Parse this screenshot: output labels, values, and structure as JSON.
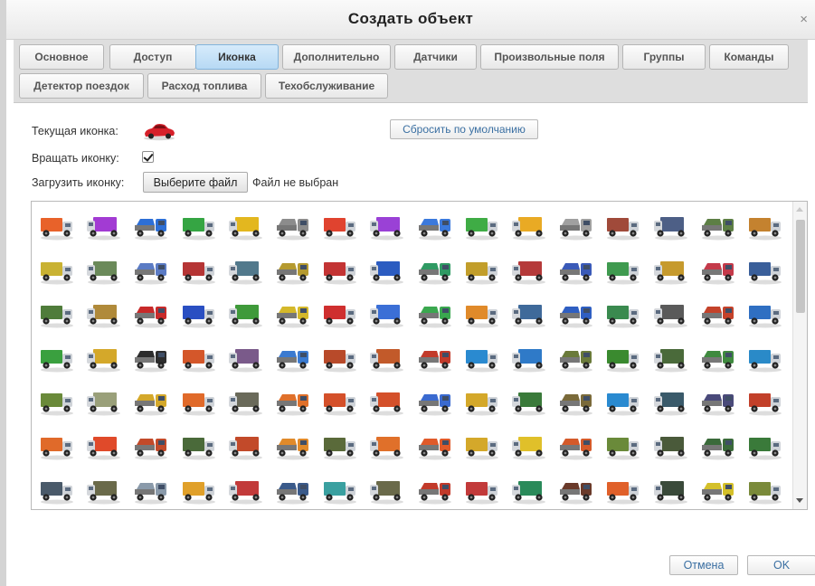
{
  "window": {
    "title": "Создать объект",
    "close_glyph": "×"
  },
  "tabs": [
    {
      "label": "Основное",
      "active": false
    },
    {
      "label": "Доступ",
      "active": false
    },
    {
      "label": "Иконка",
      "active": true
    },
    {
      "label": "Дополнительно",
      "active": false
    },
    {
      "label": "Датчики",
      "active": false
    },
    {
      "label": "Произвольные поля",
      "active": false
    },
    {
      "label": "Группы",
      "active": false
    },
    {
      "label": "Команды",
      "active": false
    },
    {
      "label": "Детектор поездок",
      "active": false
    },
    {
      "label": "Расход топлива",
      "active": false
    },
    {
      "label": "Техобслуживание",
      "active": false
    }
  ],
  "icon_settings": {
    "current_icon_label": "Текущая иконка:",
    "current_icon": "red-car-icon",
    "reset_button": "Сбросить по умолчанию",
    "rotate_label": "Вращать иконку:",
    "rotate_checked": true,
    "upload_label": "Загрузить иконку:",
    "choose_file_button": "Выберите файл",
    "file_status": "Файл не выбран"
  },
  "icon_gallery": {
    "rows": [
      [
        "#e8622a",
        "#a23bd3",
        "#2d6fd6",
        "#35a543",
        "#e3b71f",
        "#8c8c8c",
        "#e0432f",
        "#9a41d6",
        "#3b79dc",
        "#3fac45",
        "#e9aa24",
        "#a0a0a0",
        "#a04a3a",
        "#4d5f86",
        "#5d7f45",
        "#c4822f"
      ],
      [
        "#c9b233",
        "#6b8a5a",
        "#5b7bc4",
        "#b53535",
        "#52798c",
        "#b59a2f",
        "#c33434",
        "#2b5cc1",
        "#2f9a63",
        "#c29e2b",
        "#b53a3a",
        "#3a5ab8",
        "#3f9a4f",
        "#c69a2d",
        "#c43a4a",
        "#3a5f9a"
      ],
      [
        "#4f7c3a",
        "#b08a3a",
        "#c82a2a",
        "#2a4fc2",
        "#3f9a3a",
        "#d4b82a",
        "#cf2f2f",
        "#3b6fd6",
        "#3aa84f",
        "#e08a2a",
        "#3f6a9a",
        "#2f5fc2",
        "#3a8a4f",
        "#5a5a5a",
        "#c4422a",
        "#2f6fc2"
      ],
      [
        "#3aa03f",
        "#d4a82a",
        "#2d2d2d",
        "#d4572a",
        "#7a5a8a",
        "#3a7ad0",
        "#b84a2a",
        "#c25a2a",
        "#c23a2a",
        "#2a8ad0",
        "#2f7ac8",
        "#6a7a3a",
        "#3a8a2f",
        "#4a6a3a",
        "#3f8a3f",
        "#2a8ac8"
      ],
      [
        "#6a8a3a",
        "#9aa07a",
        "#d4a82a",
        "#e06a2a",
        "#6a6a5a",
        "#e0702a",
        "#d4502a",
        "#d4502a",
        "#3a6ad0",
        "#d4a82a",
        "#3a7a3a",
        "#7a6a3a",
        "#2a8ad0",
        "#3a5a6a",
        "#4a4a7a",
        "#c2402a"
      ],
      [
        "#e06a2a",
        "#e04a2a",
        "#c24a2a",
        "#4a6a3a",
        "#c24a2a",
        "#e08a2a",
        "#5a6a3a",
        "#e0702a",
        "#e05a2a",
        "#d4a82a",
        "#e0c02a",
        "#d45a2a",
        "#6a8a3a",
        "#4a5a3a",
        "#3a6a3a",
        "#3a7a3a"
      ],
      [
        "#4a5a6a",
        "#6a6a4a",
        "#8a9aaa",
        "#e0a02a",
        "#c23a3a",
        "#3a5a8a",
        "#3aa0a0",
        "#6a6a4a",
        "#c23a2a",
        "#c23a3a",
        "#2a8a5a",
        "#6a3a2a",
        "#e0602a",
        "#3a4a3a",
        "#d4c02a",
        "#7a8a3a"
      ]
    ]
  },
  "footer": {
    "cancel_button": "Отмена",
    "ok_button": "OK"
  }
}
